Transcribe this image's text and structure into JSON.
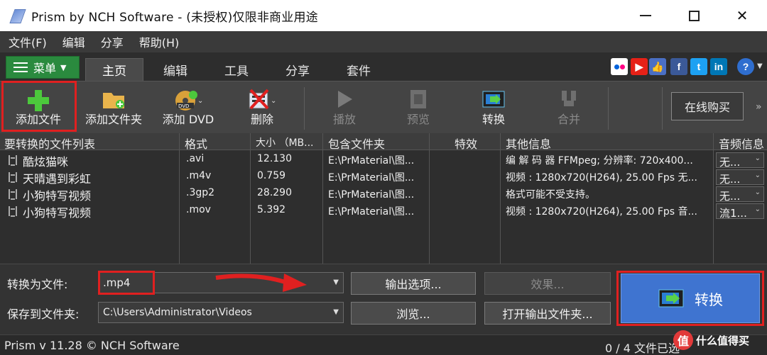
{
  "window": {
    "title": "Prism by NCH Software - (未授权)仅限非商业用途"
  },
  "menubar": [
    "文件(F)",
    "编辑",
    "分享",
    "帮助(H)"
  ],
  "ribbon": {
    "menu_label": "菜单",
    "tabs": [
      "主页",
      "编辑",
      "工具",
      "分享",
      "套件"
    ],
    "active_tab": "主页"
  },
  "toolbar": {
    "add_file": "添加文件",
    "add_folder": "添加文件夹",
    "add_dvd": "添加 DVD",
    "delete": "删除",
    "play": "播放",
    "preview": "预览",
    "convert": "转换",
    "merge": "合并",
    "buy_online": "在线购买"
  },
  "list": {
    "headers": [
      "要转换的文件列表",
      "格式",
      "大小 （MB...",
      "包含文件夹",
      "特效",
      "其他信息",
      "音频信息"
    ],
    "rows": [
      {
        "name": "酷炫猫咪",
        "format": ".avi",
        "size": "12.130",
        "folder": "E:\\PrMaterial\\图...",
        "effects": "",
        "info": "编 解 码 器 FFMpeg; 分辨率: 720x400...",
        "audio": "无..."
      },
      {
        "name": "天晴遇到彩虹",
        "format": ".m4v",
        "size": "0.759",
        "folder": "E:\\PrMaterial\\图...",
        "effects": "",
        "info": "视频 : 1280x720(H264), 25.00 Fps 无...",
        "audio": "无..."
      },
      {
        "name": "小狗特写视频",
        "format": ".3gp2",
        "size": "28.290",
        "folder": "E:\\PrMaterial\\图...",
        "effects": "",
        "info": "格式可能不受支持。",
        "audio": "无..."
      },
      {
        "name": "小狗特写视频",
        "format": ".mov",
        "size": "5.392",
        "folder": "E:\\PrMaterial\\图...",
        "effects": "",
        "info": "视频 : 1280x720(H264), 25.00 Fps 音...",
        "audio": "流1..."
      }
    ]
  },
  "bottom": {
    "convert_to_label": "转换为文件:",
    "format_value": ".mp4",
    "save_to_label": "保存到文件夹:",
    "save_path": "C:\\Users\\Administrator\\Videos",
    "output_options": "输出选项...",
    "effects": "效果...",
    "browse": "浏览...",
    "open_output": "打开输出文件夹...",
    "convert_button": "转换"
  },
  "status": {
    "left": "Prism v 11.28 © NCH Software",
    "right": "0 / 4 文件已选"
  },
  "watermark": {
    "logo": "值",
    "text": "什么值得买"
  },
  "colors": {
    "accent_green": "#2a8a3e",
    "convert_blue": "#3f74d0",
    "highlight_red": "#e02020"
  }
}
